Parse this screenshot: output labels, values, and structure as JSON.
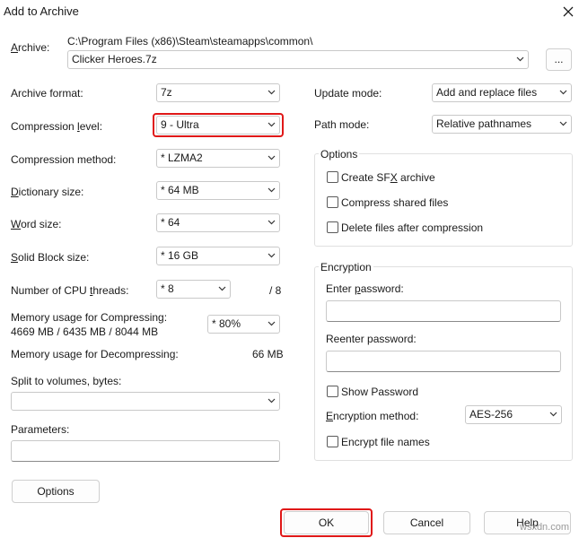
{
  "window": {
    "title": "Add to Archive"
  },
  "archive": {
    "label": "Archive:",
    "label_u": "A",
    "label_rest": "rchive:",
    "path": "C:\\Program Files (x86)\\Steam\\steamapps\\common\\",
    "filename": "Clicker Heroes.7z",
    "browse_label": "..."
  },
  "left": {
    "archive_format": {
      "label": "Archive format:",
      "value": "7z"
    },
    "compression_level": {
      "label_a": "Compression ",
      "label_u": "l",
      "label_b": "evel:",
      "value": "9 - Ultra"
    },
    "compression_method": {
      "label": "Compression method:",
      "value": "*  LZMA2"
    },
    "dictionary_size": {
      "label_u": "D",
      "label_rest": "ictionary size:",
      "value": "*  64 MB"
    },
    "word_size": {
      "label_u": "W",
      "label_rest": "ord size:",
      "value": "*  64"
    },
    "solid_block_size": {
      "label_u": "S",
      "label_rest": "olid Block size:",
      "value": "*  16 GB"
    },
    "cpu_threads": {
      "label_a": "Number of CPU ",
      "label_u": "t",
      "label_b": "hreads:",
      "value": "*  8",
      "max": "/ 8"
    },
    "memory_compress": {
      "label": "Memory usage for Compressing:",
      "detail": "4669 MB / 6435 MB / 8044 MB",
      "value": "*  80%"
    },
    "memory_decompress": {
      "label": "Memory usage for Decompressing:",
      "value": "66 MB"
    },
    "split_volumes": {
      "label": "Split to volumes, bytes:",
      "value": ""
    },
    "parameters": {
      "label": "Parameters:",
      "value": ""
    },
    "options_button": "Options"
  },
  "right": {
    "update_mode": {
      "label": "Update mode:",
      "value": "Add and replace files"
    },
    "path_mode": {
      "label": "Path mode:",
      "value": "Relative pathnames"
    },
    "options_group": {
      "title": "Options",
      "sfx": {
        "a": "Create SF",
        "u": "X",
        "b": " archive"
      },
      "shared": "Compress shared files",
      "delete": "Delete files after compression"
    },
    "encryption_group": {
      "title": "Encryption",
      "enter_password": {
        "a": "Enter ",
        "u": "p",
        "b": "assword:"
      },
      "reenter_password": "Reenter password:",
      "show_password": "Show Password",
      "method": {
        "a": "",
        "u": "E",
        "b": "ncryption method:",
        "value": "AES-256"
      },
      "encrypt_names": "Encrypt file names"
    }
  },
  "buttons": {
    "ok": "OK",
    "cancel": "Cancel",
    "help": "Help"
  },
  "watermark": "wsxdn.com",
  "colors": {
    "highlight": "#e01818",
    "border": "#c9c9c9"
  }
}
